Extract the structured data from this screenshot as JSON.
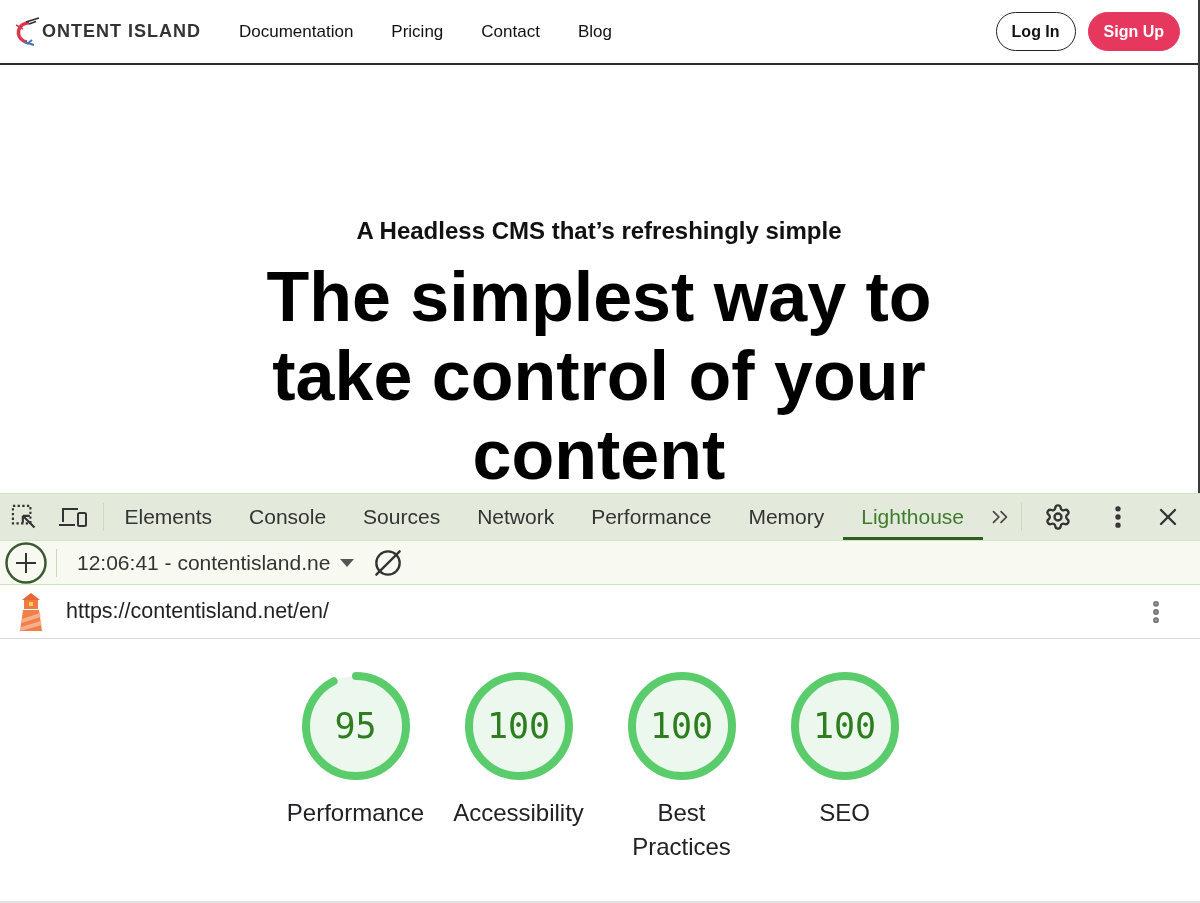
{
  "site": {
    "logo_text": "ONTENT ISLAND",
    "nav_links": [
      "Documentation",
      "Pricing",
      "Contact",
      "Blog"
    ],
    "buttons": [
      {
        "label": "Log In",
        "kind": "outline"
      },
      {
        "label": "Sign Up",
        "kind": "filled"
      }
    ]
  },
  "hero": {
    "eyebrow": "A Headless CMS that’s refreshingly simple",
    "headline": "The simplest way to take control of your content"
  },
  "devtools": {
    "tabs": [
      {
        "label": "Elements",
        "selected": false
      },
      {
        "label": "Console",
        "selected": false
      },
      {
        "label": "Sources",
        "selected": false
      },
      {
        "label": "Network",
        "selected": false
      },
      {
        "label": "Performance",
        "selected": false
      },
      {
        "label": "Memory",
        "selected": false
      },
      {
        "label": "Lighthouse",
        "selected": true
      }
    ],
    "report_select": "12:06:41 - contentisland.ne",
    "url": "https://contentisland.net/en/",
    "scores": [
      {
        "label": "Performance",
        "score": "95",
        "level": 0.95
      },
      {
        "label": "Accessibility",
        "score": "100",
        "level": 1
      },
      {
        "label": "Best Practices",
        "score": "100",
        "level": 1
      },
      {
        "label": "SEO",
        "score": "100",
        "level": 1
      }
    ]
  }
}
